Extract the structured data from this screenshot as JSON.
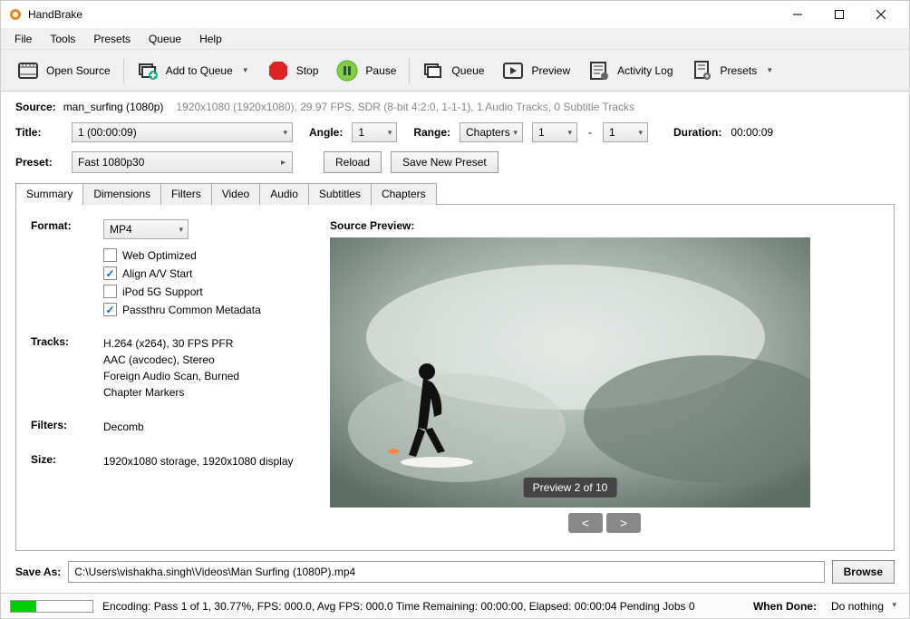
{
  "window": {
    "title": "HandBrake"
  },
  "menu": [
    "File",
    "Tools",
    "Presets",
    "Queue",
    "Help"
  ],
  "toolbar": {
    "open_source": "Open Source",
    "add_queue": "Add to Queue",
    "stop": "Stop",
    "pause": "Pause",
    "queue": "Queue",
    "preview": "Preview",
    "activity_log": "Activity Log",
    "presets": "Presets"
  },
  "source": {
    "label": "Source:",
    "name": "man_surfing (1080p)",
    "detail": "1920x1080 (1920x1080), 29.97 FPS, SDR (8-bit 4:2:0, 1-1-1), 1 Audio Tracks, 0 Subtitle Tracks"
  },
  "title_row": {
    "title_label": "Title:",
    "title_value": "1  (00:00:09)",
    "angle_label": "Angle:",
    "angle_value": "1",
    "range_label": "Range:",
    "range_type": "Chapters",
    "range_from": "1",
    "range_to": "1",
    "duration_label": "Duration:",
    "duration_value": "00:00:09"
  },
  "preset_row": {
    "label": "Preset:",
    "value": "Fast 1080p30",
    "reload": "Reload",
    "save_new": "Save New Preset"
  },
  "tabs": [
    "Summary",
    "Dimensions",
    "Filters",
    "Video",
    "Audio",
    "Subtitles",
    "Chapters"
  ],
  "summary": {
    "format_label": "Format:",
    "format_value": "MP4",
    "checks": {
      "web_optimized": {
        "label": "Web Optimized",
        "checked": false
      },
      "align_av": {
        "label": "Align A/V Start",
        "checked": true
      },
      "ipod": {
        "label": "iPod 5G Support",
        "checked": false
      },
      "passthru": {
        "label": "Passthru Common Metadata",
        "checked": true
      }
    },
    "tracks_label": "Tracks:",
    "tracks_lines": [
      "H.264 (x264), 30 FPS PFR",
      "AAC (avcodec), Stereo",
      "Foreign Audio Scan, Burned",
      "Chapter Markers"
    ],
    "filters_label": "Filters:",
    "filters_value": "Decomb",
    "size_label": "Size:",
    "size_value": "1920x1080 storage, 1920x1080 display"
  },
  "preview": {
    "label": "Source Preview:",
    "badge": "Preview 2 of 10",
    "prev": "<",
    "next": ">"
  },
  "saveas": {
    "label": "Save As:",
    "path": "C:\\Users\\vishakha.singh\\Videos\\Man Surfing (1080P).mp4",
    "browse": "Browse"
  },
  "status": {
    "progress_pct": 30.77,
    "text": "Encoding: Pass 1 of 1,  30.77%, FPS: 000.0,  Avg FPS: 000.0 Time Remaining: 00:00:00,  Elapsed: 00:00:04    Pending Jobs 0",
    "when_done_label": "When Done:",
    "when_done_value": "Do nothing"
  }
}
